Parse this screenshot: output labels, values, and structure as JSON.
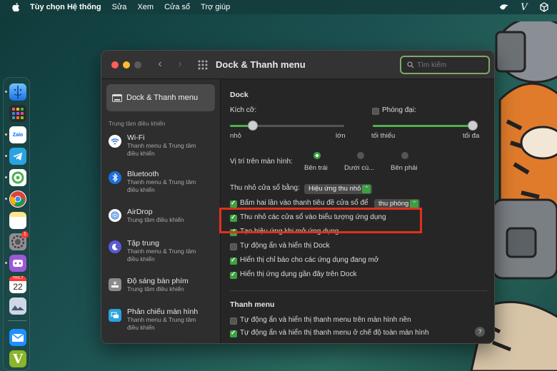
{
  "menubar": {
    "app_name": "Tùy chọn Hệ thống",
    "items": [
      "Sửa",
      "Xem",
      "Cửa sổ",
      "Trợ giúp"
    ]
  },
  "window": {
    "title": "Dock & Thanh menu",
    "search_placeholder": "Tìm kiếm"
  },
  "sidebar": {
    "selected_label": "Dock & Thanh menu",
    "group_label": "Trung tâm điều khiển",
    "items": [
      {
        "title": "Wi-Fi",
        "subtitle1": "Thanh menu & Trung tâm",
        "subtitle2": "điều khiển",
        "icon": "wifi-icon"
      },
      {
        "title": "Bluetooth",
        "subtitle1": "Thanh menu & Trung tâm",
        "subtitle2": "điều khiển",
        "icon": "bluetooth-icon"
      },
      {
        "title": "AirDrop",
        "subtitle1": "Trung tâm điều khiển",
        "subtitle2": "",
        "icon": "airdrop-icon"
      },
      {
        "title": "Tập trung",
        "subtitle1": "Thanh menu & Trung tâm",
        "subtitle2": "điều khiển",
        "icon": "moon-icon"
      },
      {
        "title": "Độ sáng bàn phím",
        "subtitle1": "Trung tâm điều khiển",
        "subtitle2": "",
        "icon": "keyboard-brightness-icon"
      },
      {
        "title": "Phản chiếu màn hình",
        "subtitle1": "Thanh menu & Trung tâm",
        "subtitle2": "điều khiển",
        "icon": "screen-mirroring-icon"
      }
    ]
  },
  "dock_section": {
    "title": "Dock",
    "size_label": "Kích cỡ:",
    "size_min": "nhỏ",
    "size_max": "lớn",
    "size_value": 0.2,
    "magnify_label": "Phóng đại:",
    "magnify_checked": false,
    "magnify_min": "tối thiểu",
    "magnify_max": "tối đa",
    "magnify_value": 1.0,
    "position_label": "Vị trí trên màn hình:",
    "positions": [
      "Bên trái",
      "Dưới cù...",
      "Bên phải"
    ],
    "position_selected": 0,
    "minimize_label": "Thu nhỏ cửa sổ bằng:",
    "minimize_effect": "Hiệu ứng thu nhỏ",
    "double_click_label": "Bấm hai lần vào thanh tiêu đề cửa sổ để",
    "double_click_action": "thu phóng",
    "checkboxes": [
      {
        "label": "Thu nhỏ các cửa sổ vào biểu tượng ứng dụng",
        "checked": true
      },
      {
        "label": "Tạo hiệu ứng khi mở ứng dụng",
        "checked": true
      },
      {
        "label": "Tự động ẩn và hiển thị Dock",
        "checked": false
      },
      {
        "label": "Hiển thị chỉ báo cho các ứng dụng đang mở",
        "checked": true
      },
      {
        "label": "Hiển thị ứng dụng gần đây trên Dock",
        "checked": true
      }
    ]
  },
  "menubar_section": {
    "title": "Thanh menu",
    "checkboxes": [
      {
        "label": "Tự động ẩn và hiển thị thanh menu trên màn hình nền",
        "checked": false
      },
      {
        "label": "Tự động ẩn và hiển thị thanh menu ở chế độ toàn màn hình",
        "checked": true
      }
    ]
  },
  "help_label": "?",
  "dock_calendar": {
    "month": "THG 7",
    "day": "22"
  },
  "dock_app_labels": {
    "zalo": "Zalo",
    "v": "V"
  },
  "badge_count": "1",
  "colors": {
    "accent": "#3ea043",
    "highlight": "#e0301e",
    "search_border": "#7fa86a"
  }
}
